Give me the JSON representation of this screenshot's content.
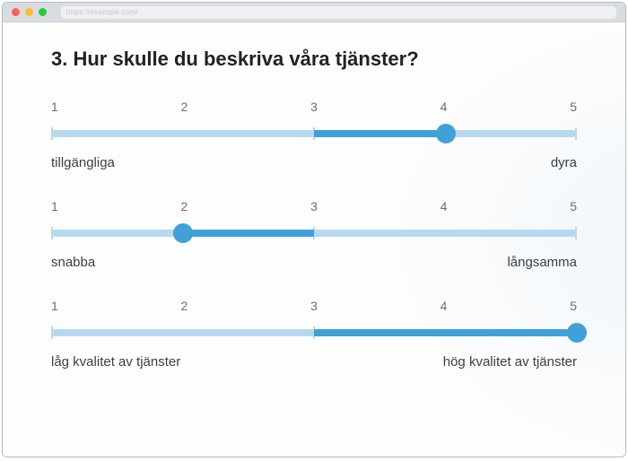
{
  "browser": {
    "url_placeholder": "https://example.com/"
  },
  "question": {
    "number": "3.",
    "text": "Hur skulle du beskriva våra tjänster?"
  },
  "sliders": [
    {
      "ticks": [
        "1",
        "2",
        "3",
        "4",
        "5"
      ],
      "left_label": "tillgängliga",
      "right_label": "dyra",
      "min": 1,
      "max": 5,
      "value": 4
    },
    {
      "ticks": [
        "1",
        "2",
        "3",
        "4",
        "5"
      ],
      "left_label": "snabba",
      "right_label": "långsamma",
      "min": 1,
      "max": 5,
      "value": 2
    },
    {
      "ticks": [
        "1",
        "2",
        "3",
        "4",
        "5"
      ],
      "left_label": "låg kvalitet av tjänster",
      "right_label": "hög kvalitet av tjänster",
      "min": 1,
      "max": 5,
      "value": 5
    }
  ],
  "colors": {
    "track": "#b6d9ef",
    "fill": "#3fa1d8",
    "thumb": "#3fa1d8"
  }
}
